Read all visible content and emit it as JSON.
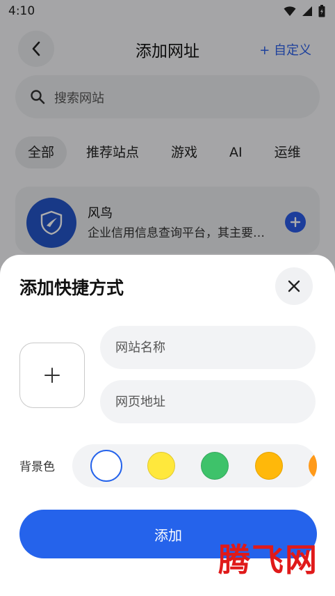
{
  "status_bar": {
    "time": "4:10"
  },
  "top_bar": {
    "title": "添加网址",
    "custom_label": "+ 自定义"
  },
  "search": {
    "placeholder": "搜索网站"
  },
  "tabs": [
    {
      "label": "全部",
      "active": true
    },
    {
      "label": "推荐站点",
      "active": false
    },
    {
      "label": "游戏",
      "active": false
    },
    {
      "label": "AI",
      "active": false
    },
    {
      "label": "运维",
      "active": false
    }
  ],
  "site_card": {
    "name": "风鸟",
    "description": "企业信用信息查询平台，其主要…"
  },
  "sheet": {
    "title": "添加快捷方式",
    "name_placeholder": "网站名称",
    "url_placeholder": "网页地址",
    "bg_color_label": "背景色",
    "colors": [
      "#ffffff",
      "#ffe83c",
      "#3ec26a",
      "#ffb80a",
      "#ff9a1a"
    ],
    "add_label": "添加"
  },
  "watermark": "腾飞网",
  "colors": {
    "accent": "#2563eb",
    "logo_bg": "#2454c7"
  }
}
